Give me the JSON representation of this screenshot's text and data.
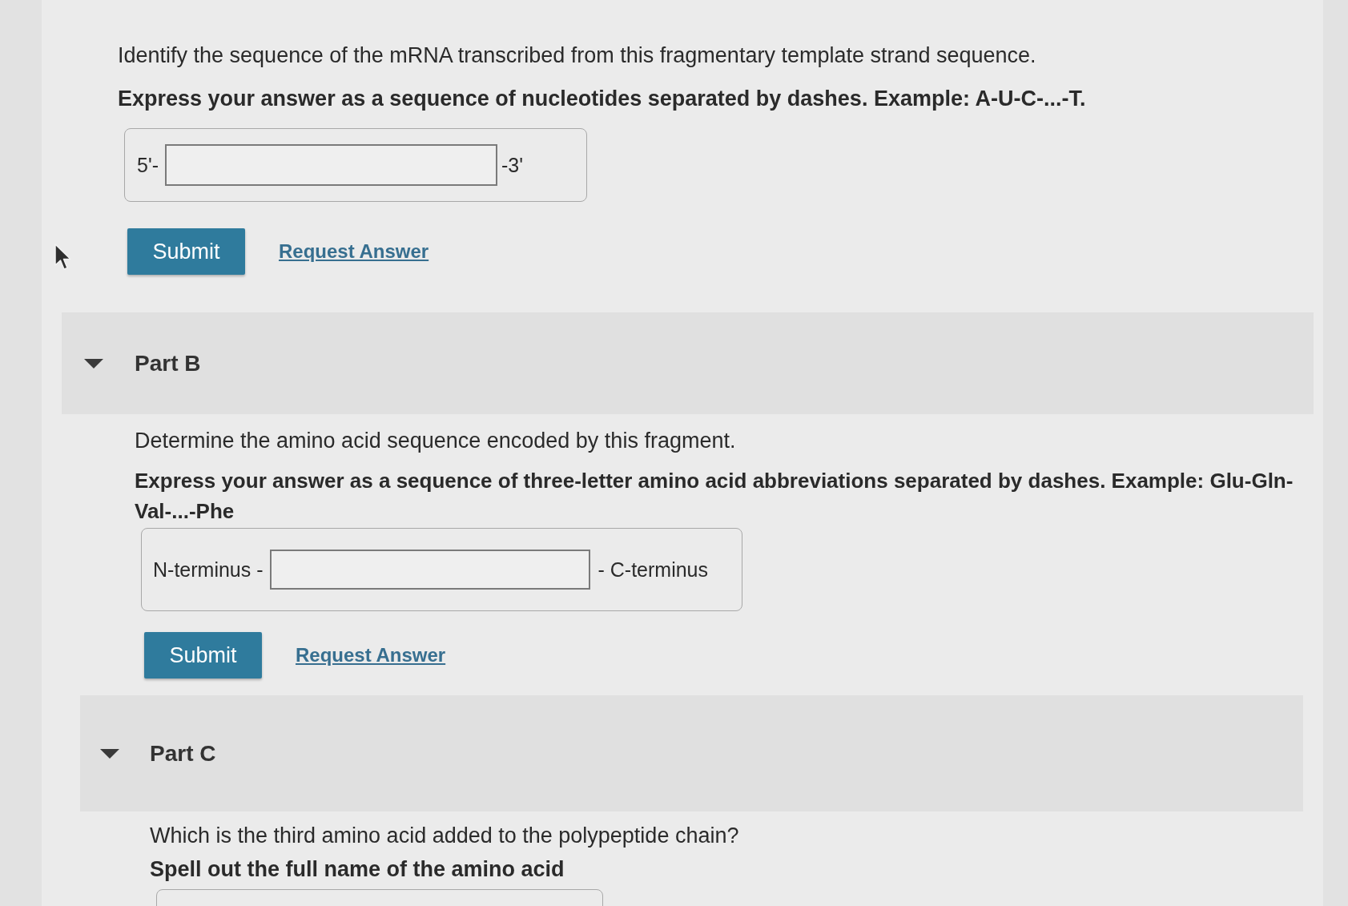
{
  "sections": [
    {
      "question": "Identify the sequence of the mRNA transcribed from this fragmentary template strand sequence.",
      "instruction": "Express your answer as a sequence of nucleotides separated by dashes. Example: A-U-C-...-T.",
      "answer": {
        "kind": "bracketed",
        "prefix": "5'-",
        "suffix": "-3'"
      },
      "actions": {
        "submit": "Submit",
        "request": "Request Answer"
      }
    },
    {
      "title": "Part B",
      "expanded": true,
      "question": "Determine the amino acid sequence encoded by this fragment.",
      "instruction": "Express your answer as a sequence of three-letter amino acid abbreviations separated by dashes. Example: Glu-Gln-Val-...-Phe",
      "answer": {
        "kind": "bracketed",
        "prefix": "N-terminus -",
        "suffix": "- C-terminus"
      },
      "actions": {
        "submit": "Submit",
        "request": "Request Answer"
      }
    },
    {
      "title": "Part C",
      "expanded": true,
      "question": "Which is the third amino acid added to the polypeptide chain?",
      "instruction": "Spell out the full name of the amino acid",
      "answer": {
        "kind": "text_box"
      }
    }
  ]
}
